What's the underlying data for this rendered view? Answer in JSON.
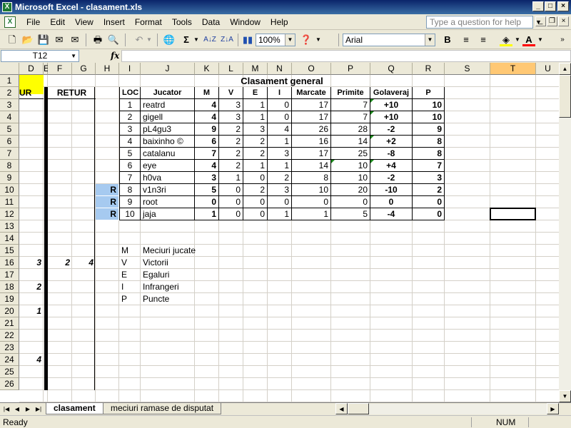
{
  "window": {
    "title": "Microsoft Excel - clasament.xls",
    "icon": "excel-icon"
  },
  "menu": {
    "items": [
      "File",
      "Edit",
      "View",
      "Insert",
      "Format",
      "Tools",
      "Data",
      "Window",
      "Help"
    ],
    "help_placeholder": "Type a question for help"
  },
  "toolbar": {
    "zoom": "100%",
    "font": "Arial",
    "bold_label": "B",
    "font_color_label": "A"
  },
  "formula_bar": {
    "name_box": "T12",
    "fx_label": "fx",
    "content": ""
  },
  "columns": [
    "D",
    "E",
    "F",
    "G",
    "H",
    "I",
    "J",
    "K",
    "L",
    "M",
    "N",
    "O",
    "P",
    "Q",
    "R",
    "S",
    "T",
    "U"
  ],
  "selected_column": "T",
  "rows": [
    "1",
    "2",
    "3",
    "4",
    "5",
    "6",
    "7",
    "8",
    "9",
    "10",
    "11",
    "12",
    "13",
    "14",
    "15",
    "16",
    "17",
    "18",
    "19",
    "20",
    "21",
    "22",
    "23",
    "24",
    "25",
    "26"
  ],
  "sheet": {
    "title": "Clasament general",
    "tur_header": "UR",
    "retur_header": "RETUR",
    "table_headers": [
      "LOC",
      "Jucator",
      "M",
      "V",
      "E",
      "I",
      "Marcate",
      "Primite",
      "Golaveraj",
      "P"
    ],
    "table_rows": [
      {
        "loc": "1",
        "jucator": "reatrd",
        "m": "4",
        "v": "3",
        "e": "1",
        "i": "0",
        "marcate": "17",
        "primite": "7",
        "golaveraj": "+10",
        "p": "10",
        "flag": ""
      },
      {
        "loc": "2",
        "jucator": "gigell",
        "m": "4",
        "v": "3",
        "e": "1",
        "i": "0",
        "marcate": "17",
        "primite": "7",
        "golaveraj": "+10",
        "p": "10",
        "flag": ""
      },
      {
        "loc": "3",
        "jucator": "pL4gu3",
        "m": "9",
        "v": "2",
        "e": "3",
        "i": "4",
        "marcate": "26",
        "primite": "28",
        "golaveraj": "-2",
        "p": "9",
        "flag": ""
      },
      {
        "loc": "4",
        "jucator": "baixinho ©",
        "m": "6",
        "v": "2",
        "e": "2",
        "i": "1",
        "marcate": "16",
        "primite": "14",
        "golaveraj": "+2",
        "p": "8",
        "flag": ""
      },
      {
        "loc": "5",
        "jucator": "catalanu",
        "m": "7",
        "v": "2",
        "e": "2",
        "i": "3",
        "marcate": "17",
        "primite": "25",
        "golaveraj": "-8",
        "p": "8",
        "flag": ""
      },
      {
        "loc": "6",
        "jucator": "eye",
        "m": "4",
        "v": "2",
        "e": "1",
        "i": "1",
        "marcate": "14",
        "primite": "10",
        "golaveraj": "+4",
        "p": "7",
        "flag": ""
      },
      {
        "loc": "7",
        "jucator": "h0va",
        "m": "3",
        "v": "1",
        "e": "0",
        "i": "2",
        "marcate": "8",
        "primite": "10",
        "golaveraj": "-2",
        "p": "3",
        "flag": ""
      },
      {
        "loc": "8",
        "jucator": "v1n3ri",
        "m": "5",
        "v": "0",
        "e": "2",
        "i": "3",
        "marcate": "10",
        "primite": "20",
        "golaveraj": "-10",
        "p": "2",
        "flag": "R"
      },
      {
        "loc": "9",
        "jucator": "root",
        "m": "0",
        "v": "0",
        "e": "0",
        "i": "0",
        "marcate": "0",
        "primite": "0",
        "golaveraj": "0",
        "p": "0",
        "flag": "R"
      },
      {
        "loc": "10",
        "jucator": "jaja",
        "m": "1",
        "v": "0",
        "e": "0",
        "i": "1",
        "marcate": "1",
        "primite": "5",
        "golaveraj": "-4",
        "p": "0",
        "flag": "R"
      }
    ],
    "legend": [
      {
        "code": "M",
        "label": "Meciuri jucate"
      },
      {
        "code": "V",
        "label": "Victorii"
      },
      {
        "code": "E",
        "label": "Egaluri"
      },
      {
        "code": "I",
        "label": "Infrangeri"
      },
      {
        "code": "P",
        "label": "Puncte"
      }
    ],
    "left_values": [
      {
        "row": "16",
        "col": "D",
        "value": "3"
      },
      {
        "row": "16",
        "col": "F",
        "value": "2"
      },
      {
        "row": "16",
        "col": "G",
        "value": "4"
      },
      {
        "row": "18",
        "col": "D",
        "value": "2"
      },
      {
        "row": "20",
        "col": "D",
        "value": "1"
      },
      {
        "row": "24",
        "col": "D",
        "value": "4"
      }
    ]
  },
  "sheet_tabs": [
    "clasament",
    "meciuri ramase de disputat"
  ],
  "active_tab": "clasament",
  "status": {
    "text": "Ready",
    "num": "NUM"
  },
  "colors": {
    "title_bar": "#0a246a",
    "highlight_yellow": "#ffff00",
    "flag_blue": "#a6caf0",
    "selected_header": "#ffc874"
  }
}
